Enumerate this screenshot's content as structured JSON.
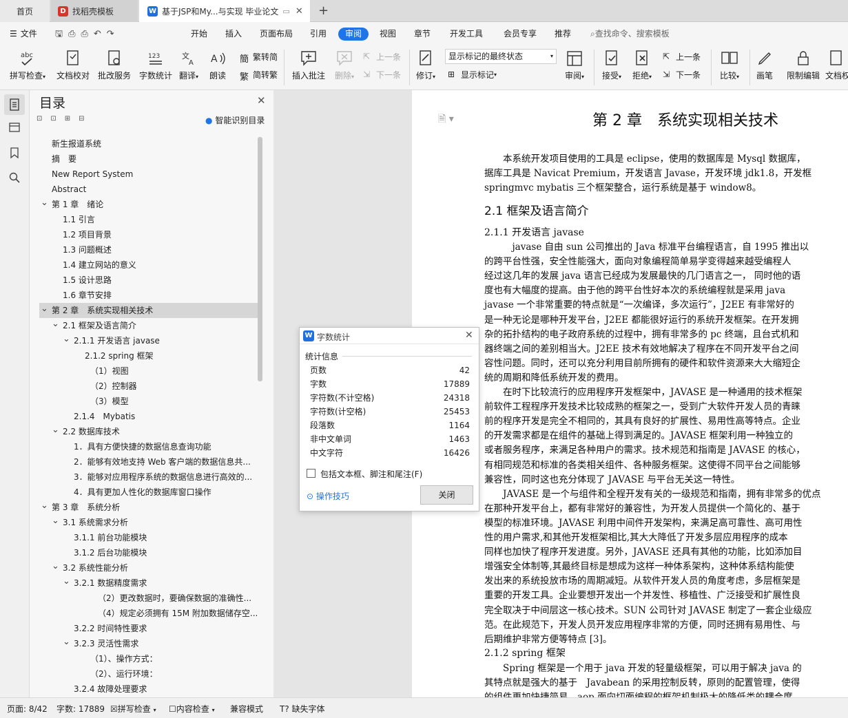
{
  "tabs": {
    "home": "首页",
    "t1": "找稻壳模板",
    "t2": "基于JSP和My...与实现 毕业论文"
  },
  "menu": {
    "file": "文件",
    "items": [
      "开始",
      "插入",
      "页面布局",
      "引用",
      "审阅",
      "视图",
      "章节",
      "开发工具",
      "会员专享",
      "推荐"
    ],
    "active": "审阅",
    "search": "查找命令、搜索模板"
  },
  "ribbon": {
    "spellcheck": "拼写检查",
    "doccheck": "文档校对",
    "annotate_service": "批改服务",
    "wordcount": "字数统计",
    "translate": "翻译",
    "read": "朗读",
    "trad": "繁转简",
    "simp": "简转繁",
    "insert_comment": "插入批注",
    "delete": "删除",
    "prev": "上一条",
    "next": "下一条",
    "revise": "修订",
    "markup_select": "显示标记的最终状态",
    "show_markup": "显示标记",
    "review": "审阅",
    "accept": "接受",
    "reject": "拒绝",
    "prev2": "上一条",
    "next2": "下一条",
    "compare": "比较",
    "pen": "画笔",
    "restrict": "限制编辑",
    "protect": "文档权"
  },
  "toc": {
    "title": "目录",
    "smart": "智能识别目录",
    "items": [
      "新生报道系统",
      "摘　要",
      "New Report System",
      "Abstract",
      "第 1 章　绪论",
      "1.1 引言",
      "1.2 项目背景",
      "1.3 问题概述",
      "1.4 建立网站的意义",
      "1.5 设计思路",
      "1.6 章节安排",
      "第 2 章　系统实现相关技术",
      "2.1 框架及语言简介",
      "2.1.1 开发语言 javase",
      "2.1.2 spring 框架",
      "（1）视图",
      "（2）控制器",
      "（3）模型",
      "2.1.4　Mybatis",
      "2.2 数据库技术",
      "1．具有方便快捷的数据信息查询功能",
      "2．能够有效地支持 Web 客户端的数据信息共...",
      "3．能够对应用程序系统的数据信息进行高效的...",
      "4．具有更加人性化的数据库窗口操作",
      "第 3 章　系统分析",
      "3.1 系统需求分析",
      "3.1.1 前台功能模块",
      "3.1.2 后台功能模块",
      "3.2 系统性能分析",
      "3.2.1 数据精度需求",
      "（2）更改数据时，要确保数据的准确性...",
      "（4）规定必须拥有 15M 附加数据储存空...",
      "3.2.2 时间特性要求",
      "3.2.3 灵活性需求",
      "（1）、操作方式：",
      "（2）、运行环境：",
      "3.2.4 故障处理要求"
    ]
  },
  "doc": {
    "chapter_title": "第 2 章　系统实现相关技术",
    "lines": [
      "　　本系统开发项目使用的工具是 eclipse，使用的数据库是 Mysql 数据库，",
      "据库工具是 Navicat Premium，开发语言 Javase，开发环境 jdk1.8，开发框",
      "springmvc mybatis 三个框架整合，运行系统是基于 window8。",
      "2.1 框架及语言简介",
      "2.1.1 开发语言 javase",
      "　　　javase 自由 sun 公司推出的 Java 标准平台编程语言，自 1995 推出以",
      "的跨平台性强，安全性能强大，面向对象编程简单易学变得越来越受编程人",
      "经过这几年的发展 java 语言已经成为发展最快的几门语言之一， 同时他的语",
      "度也有大幅度的提高。由于他的跨平台性好本次的系统编程就是采用 java",
      "javase 一个非常重要的特点就是“一次编译，多次运行”，J2EE 有非常好的",
      "是一种无论是哪种开发平台，J2EE 都能很好运行的系统开发框架。在开发拥",
      "杂的拓扑结构的电子政府系统的过程中，拥有非常多的 pc 终端，且台式机和",
      "器终端之间的差别相当大。J2EE 技术有效地解决了程序在不同开发平台之间",
      "容性问题。同时，还可以充分利用目前所拥有的硬件和软件资源来大大缩短企",
      "统的周期和降低系统开发的费用。",
      "　　在时下比较流行的应用程序开发框架中，JAVASE 是一种通用的技术框架",
      "前软件工程程序开发技术比较成熟的框架之一，受到广大软件开发人员的青睐",
      "前的程序开发是完全不相同的，其具有良好的扩展性、易用性高等特点。企业",
      "的开发需求都是在组件的基础上得到满足的。JAVASE 框架利用一种独立的",
      "或者服务程序，来满足各种用户的需求。技术规范和指南是 JAVASE 的核心，",
      "有相同规范和标准的各类相关组件、各种服务框架。这使得不同平台之间能够",
      "兼容性，同时这也充分体现了 JAVASE 与平台无关这一特性。",
      "　　JAVASE 是一个与组件和全程开发有关的一级规范和指南，拥有非常多的优点",
      "在那种开发平台上，都有非常好的兼容性，为开发人员提供一个简化的、基于",
      "模型的标准环境。JAVASE 利用中间件开发架构，来满足高可靠性、高可用性",
      "性的用户需求,和其他开发框架相比,其大大降低了开发多层应用程序的成本",
      "同样也加快了程序开发进度。另外，JAVASE 还具有其他的功能，比如添加目",
      "增强安全体制等,其最终目标是想成为这样一种体系架构，这种体系结构能使",
      "发出来的系统投放市场的周期减短。从软件开发人员的角度考虑，多层框架是",
      "重要的开发工具。企业要想开发出一个并发性、移植性、广泛接受和扩展性良",
      "完全取决于中间层这一核心技术。SUN 公司针对 JAVASE 制定了一套企业级应",
      "范。在此规范下，开发人员开发应用程序非常的方便，同时还拥有易用性、与",
      "后期维护非常方便等特点 [3]。",
      "2.1.2 spring 框架",
      "　　Spring 框架是一个用于 java 开发的轻量级框架，可以用于解决 java 的",
      "其特点就是强大的基于　Javabean 的采用控制反转，原则的配置管理，使得",
      "的组件更加快捷简易。aop 面向切面编程的框架机制极大的降低类的耦合度，"
    ]
  },
  "dialog": {
    "title": "字数统计",
    "section": "统计信息",
    "rows": [
      {
        "label": "页数",
        "value": "42"
      },
      {
        "label": "字数",
        "value": "17889"
      },
      {
        "label": "字符数(不计空格)",
        "value": "24318"
      },
      {
        "label": "字符数(计空格)",
        "value": "25453"
      },
      {
        "label": "段落数",
        "value": "1164"
      },
      {
        "label": "非中文单词",
        "value": "1463"
      },
      {
        "label": "中文字符",
        "value": "16426"
      }
    ],
    "checkbox": "包括文本框、脚注和尾注(F)",
    "tips": "操作技巧",
    "close": "关闭"
  },
  "status": {
    "page": "页面: 8/42",
    "words": "字数: 17889",
    "spell": "拼写检查",
    "content": "内容检查",
    "compat": "兼容模式",
    "missing_font": "缺失字体"
  },
  "colors": {
    "accent": "#1f74e8",
    "wps_blue": "#1f6fe0",
    "docer_red": "#d9342b"
  }
}
